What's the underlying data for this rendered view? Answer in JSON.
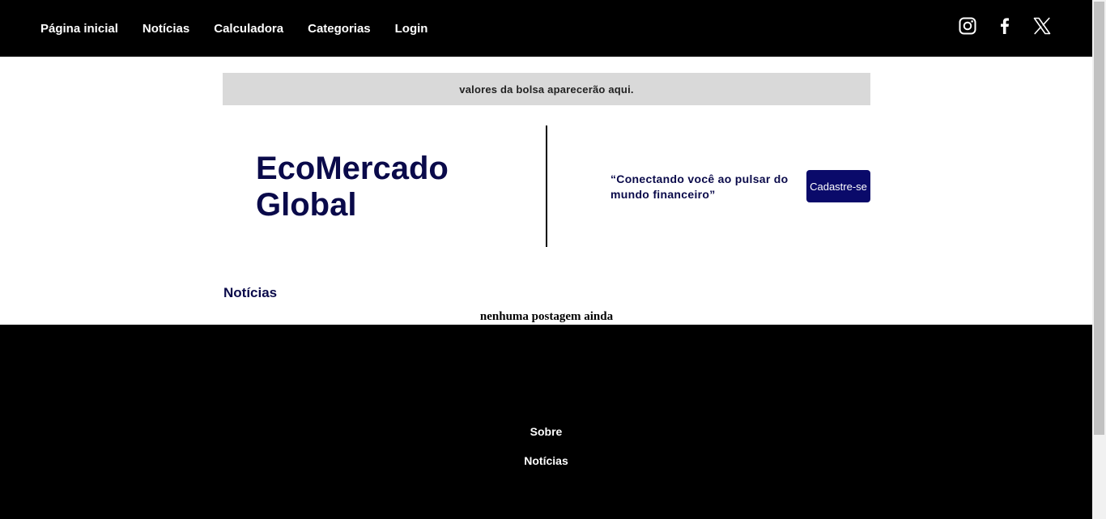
{
  "nav": {
    "items": [
      {
        "label": "Página inicial"
      },
      {
        "label": "Notícias"
      },
      {
        "label": "Calculadora"
      },
      {
        "label": "Categorias"
      },
      {
        "label": "Login"
      }
    ]
  },
  "social": {
    "icons": [
      "instagram-icon",
      "facebook-icon",
      "x-twitter-icon"
    ]
  },
  "ticker": {
    "text": "valores da bolsa aparecerão aqui."
  },
  "hero": {
    "brand": "EcoMercado Global",
    "tagline": "“Conectando você ao pulsar do mundo financeiro”",
    "cta_label": "Cadastre-se"
  },
  "news": {
    "title": "Notícias",
    "empty_message": "nenhuma postagem ainda"
  },
  "footer": {
    "links": [
      {
        "label": "Sobre"
      },
      {
        "label": "Notícias"
      }
    ]
  },
  "colors": {
    "header_bg": "#000000",
    "brand_navy": "#0a0a4a",
    "button_bg": "#0a0a6a",
    "ticker_bg": "#d9d9d9"
  }
}
